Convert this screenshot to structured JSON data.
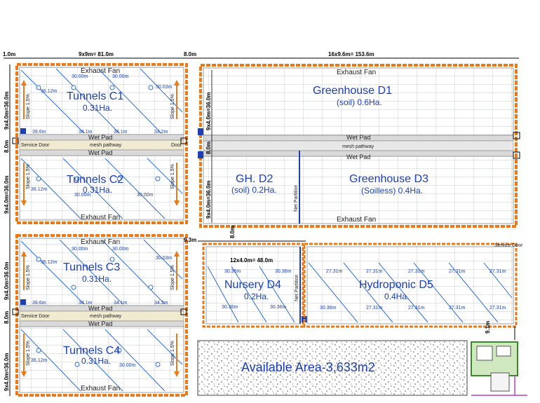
{
  "colors": {
    "frame": "#e87a1a",
    "frame_inner": "#f4b070",
    "grid": "#9aa0a6",
    "diag": "#2f6fd0",
    "label": "#1d3fb5",
    "pad_fill": "#d9d9d9",
    "pathway_fill": "#f0ead0",
    "gravel_fill": "#eeeeee"
  },
  "top_dims": {
    "left_margin": "1.0m",
    "tunnels_width": "9x9m= 81.0m",
    "gap": "8.0m",
    "greenhouse_width": "16x9.6m= 153.6m"
  },
  "side_dims": {
    "c1": "9x4.0m=36.0m",
    "c2": "9x4.0m=36.0m",
    "c3": "9x4.0m=36.0m",
    "c4": "9x4.0m=36.0m",
    "gap_upper": "8.0m",
    "gap_lower": "8.0m",
    "d1": "9x4.0m=36.0m",
    "d3": "9x4.0m=36.0m",
    "d_mid": "8.0m",
    "d4_gap": "9.3m",
    "d4_side": "8.0m",
    "d5_gap": "9.1m"
  },
  "tunnels": {
    "c1": {
      "name": "Tunnels  C1",
      "area": "0.31Ha.",
      "fan": "Exhaust Fan"
    },
    "c2": {
      "name": "Tunnels  C2",
      "area": "0.31Ha.",
      "fan": "Exhaust Fan"
    },
    "c3": {
      "name": "Tunnels  C3",
      "area": "0.31Ha.",
      "fan": "Exhaust Fan"
    },
    "c4": {
      "name": "Tunnels  C4",
      "area": "0.31Ha.",
      "fan": "Exhaust Fan"
    },
    "wet_pad": "Wet Pad",
    "mesh_pathway": "mesh pathway",
    "service_door": "Service Door",
    "door": "Door",
    "slope": "Slope  1.5%",
    "lengths": [
      "36.12m",
      "30.00m",
      "30.00m",
      "30.03m",
      "39.6m",
      "34.1m",
      "34.1m",
      "34.2m"
    ]
  },
  "greenhouse": {
    "d1": {
      "name": "Greenhouse  D1",
      "area": "(soil) 0.6Ha."
    },
    "d2": {
      "name": "GH.  D2",
      "area": "(soil) 0.2Ha."
    },
    "d3": {
      "name": "Greenhouse  D3",
      "area": "(Soilless) 0.4Ha."
    },
    "exhaust_top": "Exhaust Fan",
    "exhaust_bottom": "Exhaust Fan",
    "wet_pad": "Wet Pad",
    "mesh_pathway": "mesh pathway",
    "net_partition": "Net Partition"
  },
  "nursery": {
    "name": "Nursery  D4",
    "area": "0.2Ha.",
    "width": "12x4.0m= 48.0m",
    "lengths": [
      "30.36m",
      "30.36m",
      "30.36m",
      "30.36m"
    ],
    "net_partition": "Net Partition"
  },
  "hydroponic": {
    "name": "Hydroponic  D5",
    "area": "0.4Ha.",
    "lengths": [
      "27.31m",
      "27.31m",
      "27.31m",
      "27.31m",
      "27.31m",
      "27.31m",
      "27.31m",
      "27.31m",
      "27.31m",
      "30.36m"
    ],
    "service_door": "Service Door"
  },
  "available": {
    "label": "Available Area-3,633m2"
  }
}
